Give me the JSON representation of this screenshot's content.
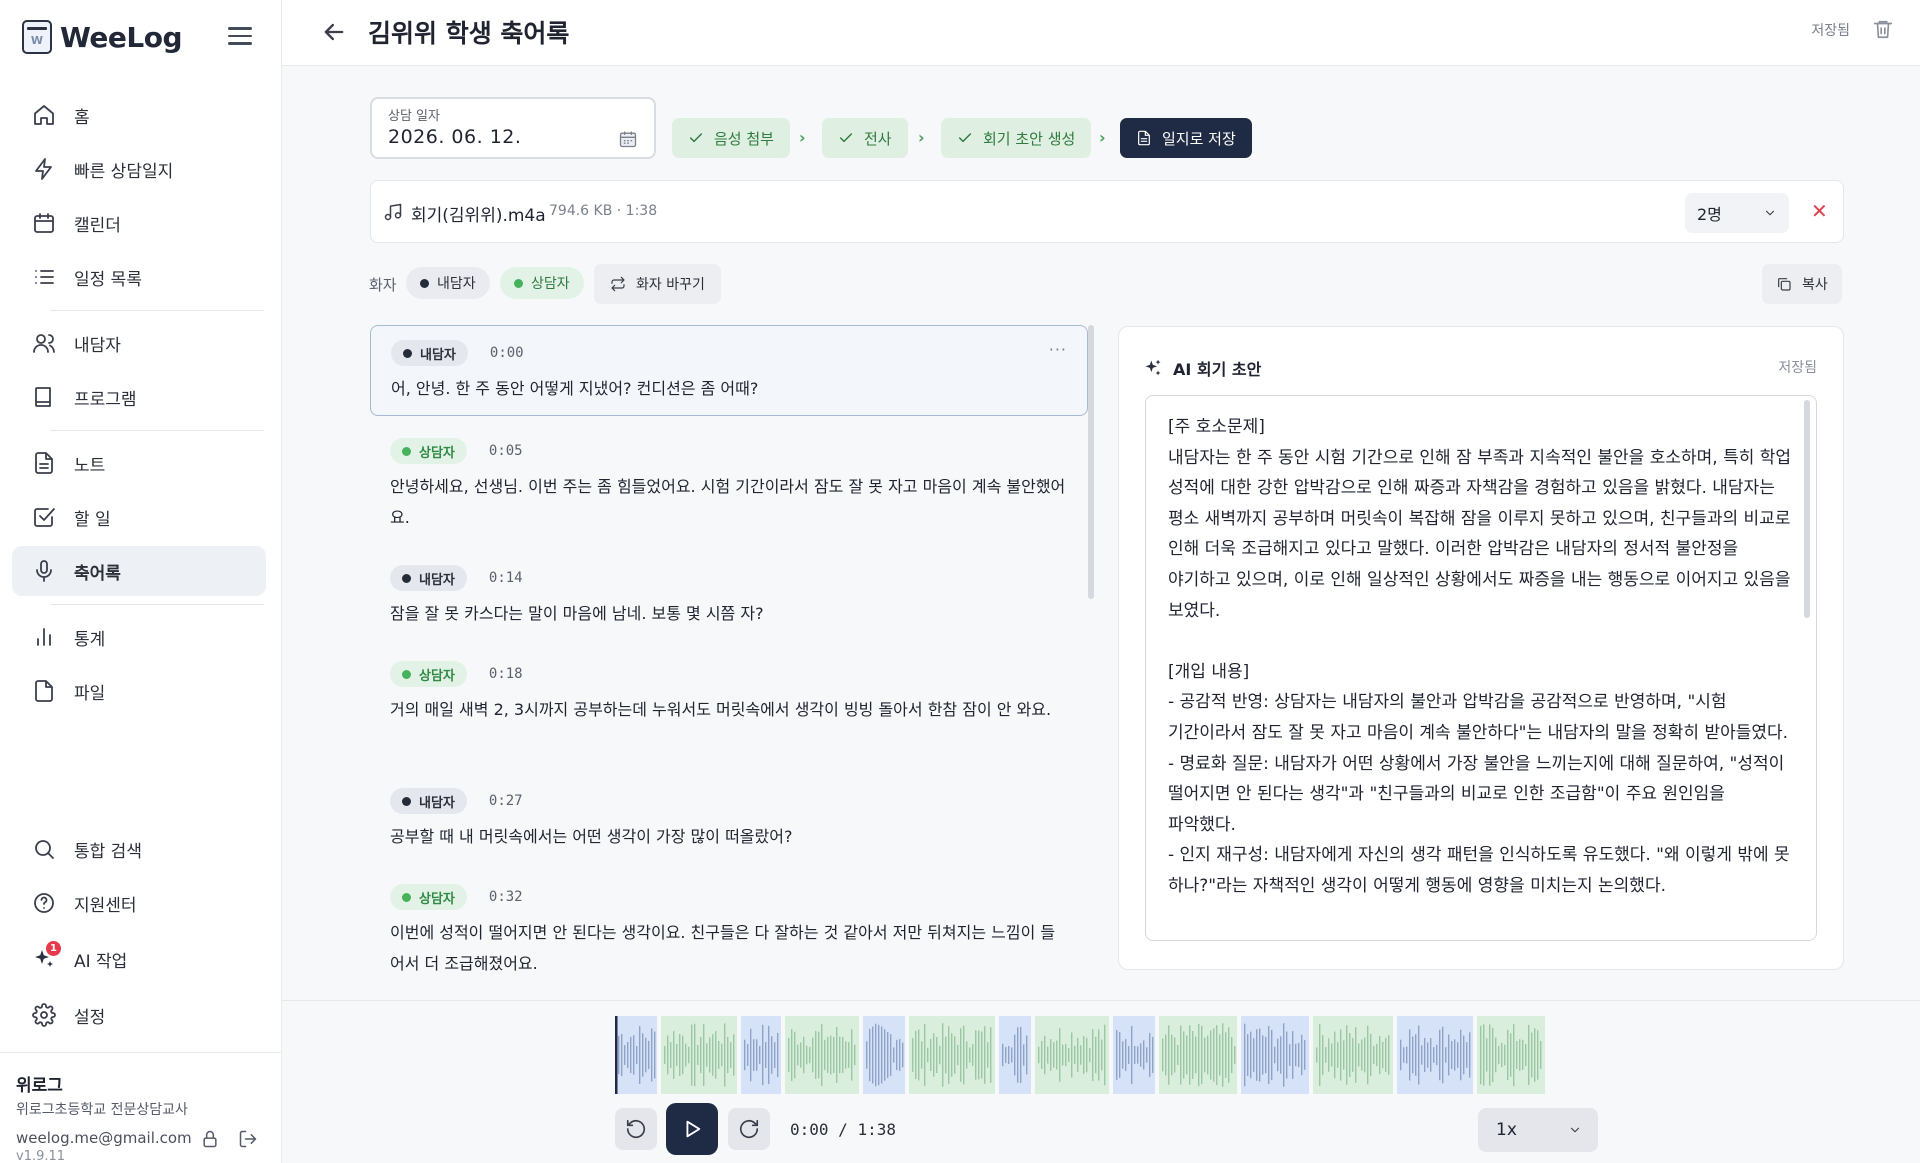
{
  "sidebar": {
    "brand": "WeeLog",
    "nav": [
      {
        "label": "홈",
        "icon": "home-icon"
      },
      {
        "label": "빠른 상담일지",
        "icon": "lightning-icon"
      },
      {
        "label": "캘린더",
        "icon": "calendar-icon"
      },
      {
        "label": "일정 목록",
        "icon": "list-icon"
      },
      {
        "label": "내담자",
        "icon": "users-icon"
      },
      {
        "label": "프로그램",
        "icon": "book-icon"
      },
      {
        "label": "노트",
        "icon": "note-icon"
      },
      {
        "label": "할 일",
        "icon": "checkbox-icon"
      },
      {
        "label": "축어록",
        "icon": "microphone-icon",
        "active": true
      },
      {
        "label": "통계",
        "icon": "bar-chart-icon"
      },
      {
        "label": "파일",
        "icon": "file-icon"
      },
      {
        "label": "통합 검색",
        "icon": "search-icon"
      },
      {
        "label": "지원센터",
        "icon": "help-icon"
      },
      {
        "label": "AI 작업",
        "icon": "sparkle-icon",
        "badge": "1"
      },
      {
        "label": "설정",
        "icon": "gear-icon"
      }
    ],
    "profile": {
      "name": "위로그",
      "org": "위로그초등학교 전문상담교사",
      "email": "weelog.me@gmail.com",
      "version": "v1.9.11"
    }
  },
  "header": {
    "title": "김위위 학생 축어록",
    "status": "저장됨"
  },
  "session": {
    "date_label": "상담 일자",
    "date_value": "2026. 06. 12.",
    "steps": [
      {
        "label": "음성 첨부",
        "state": "done"
      },
      {
        "label": "전사",
        "state": "done"
      },
      {
        "label": "회기 초안 생성",
        "state": "done"
      },
      {
        "label": "일지로 저장",
        "state": "current"
      }
    ]
  },
  "file": {
    "name": "회기(김위위).m4a",
    "meta": "794.6 KB · 1:38",
    "speaker_count": "2명"
  },
  "speakers": {
    "label": "화자",
    "client": "내담자",
    "counselor": "상담자",
    "swap_label": "화자 바꾸기",
    "copy_label": "복사"
  },
  "transcript": [
    {
      "speaker": "내담자",
      "role": "client",
      "time": "0:00",
      "text": "어, 안녕. 한 주 동안 어떻게 지냈어? 컨디션은 좀 어때?",
      "selected": true
    },
    {
      "speaker": "상담자",
      "role": "counselor",
      "time": "0:05",
      "text": "안녕하세요, 선생님. 이번 주는 좀 힘들었어요. 시험 기간이라서 잠도 잘 못 자고 마음이 계속 불안했어요."
    },
    {
      "speaker": "내담자",
      "role": "client",
      "time": "0:14",
      "text": "잠을 잘 못 카스다는 말이 마음에 남네. 보통 몇 시쯤 자?"
    },
    {
      "speaker": "상담자",
      "role": "counselor",
      "time": "0:18",
      "text": "거의 매일 새벽 2, 3시까지 공부하는데 누워서도 머릿속에서 생각이 빙빙 돌아서 한참 잠이 안 와요."
    },
    {
      "speaker": "내담자",
      "role": "client",
      "time": "0:27",
      "text": "공부할 때 내 머릿속에서는 어떤 생각이 가장 많이 떠올랐어?"
    },
    {
      "speaker": "상담자",
      "role": "counselor",
      "time": "0:32",
      "text": "이번에 성적이 떨어지면 안 된다는 생각이요. 친구들은 다 잘하는 것 같아서 저만 뒤쳐지는 느낌이 들어서 더 조급해졌어요."
    }
  ],
  "ai_draft": {
    "title": "AI 회기 초안",
    "status": "저장됨",
    "text": "[주 호소문제]\n내담자는 한 주 동안 시험 기간으로 인해 잠 부족과 지속적인 불안을 호소하며, 특히 학업 성적에 대한 강한 압박감으로 인해 짜증과 자책감을 경험하고 있음을 밝혔다. 내담자는 평소 새벽까지 공부하며 머릿속이 복잡해 잠을 이루지 못하고 있으며, 친구들과의 비교로 인해 더욱 조급해지고 있다고 말했다. 이러한 압박감은 내담자의 정서적 불안정을 야기하고 있으며, 이로 인해 일상적인 상황에서도 짜증을 내는 행동으로 이어지고 있음을 보였다.\n\n[개입 내용]\n- 공감적 반영: 상담자는 내담자의 불안과 압박감을 공감적으로 반영하며, \"시험 기간이라서 잠도 잘 못 자고 마음이 계속 불안하다\"는 내담자의 말을 정확히 받아들였다.\n- 명료화 질문: 내담자가 어떤 상황에서 가장 불안을 느끼는지에 대해 질문하여, \"성적이 떨어지면 안 된다는 생각\"과 \"친구들과의 비교로 인한 조급함\"이 주요 원인임을 파악했다.\n- 인지 재구성: 내담자에게 자신의 생각 패턴을 인식하도록 유도했다. \"왜 이렇게 밖에 못 하나?\"라는 자책적인 생각이 어떻게 행동에 영향을 미치는지 논의했다."
  },
  "player": {
    "current": "0:00",
    "separator": "/",
    "duration": "1:38",
    "speed": "1x",
    "progress": 0
  },
  "colors": {
    "primary": "#1f2a44",
    "step_done_bg": "#dff0e2",
    "step_done_fg": "#2f7a3f",
    "client_dot": "#262b3a",
    "counselor_dot": "#46b35a",
    "danger": "#e0414f",
    "wave_client": "#d6e2f7",
    "wave_counselor": "#d9eedc"
  }
}
